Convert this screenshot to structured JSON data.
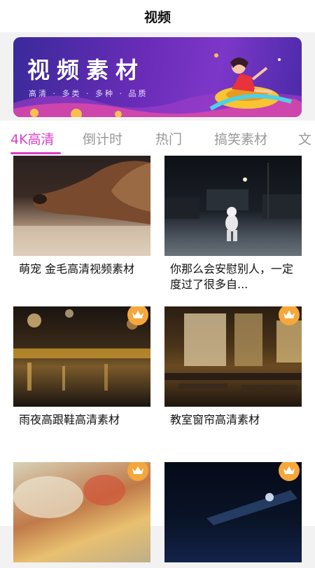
{
  "header": {
    "title": "视频"
  },
  "banner": {
    "title": "视频素材",
    "subtitle": "高清 · 多类 · 多种 · 品质"
  },
  "tabs": [
    {
      "label": "4K高清",
      "active": true
    },
    {
      "label": "倒计时",
      "active": false
    },
    {
      "label": "热门",
      "active": false
    },
    {
      "label": "搞笑素材",
      "active": false
    },
    {
      "label": "文",
      "active": false
    }
  ],
  "cards": [
    {
      "caption": "萌宠 金毛高清视频素材",
      "premium": false,
      "thumb": "golden-retriever"
    },
    {
      "caption": "你那么会安慰别人，一定度过了很多自...",
      "premium": false,
      "thumb": "night-street-astronaut"
    },
    {
      "caption": "雨夜高跟鞋高清素材",
      "premium": true,
      "thumb": "rainy-night-reflection"
    },
    {
      "caption": "教室窗帘高清素材",
      "premium": true,
      "thumb": "classroom-curtains"
    },
    {
      "caption": "",
      "premium": true,
      "thumb": "food-closeup"
    },
    {
      "caption": "",
      "premium": true,
      "thumb": "dark-light-beam"
    }
  ],
  "colors": {
    "accent": "#d93fc8",
    "crown": "#f4a73b"
  }
}
